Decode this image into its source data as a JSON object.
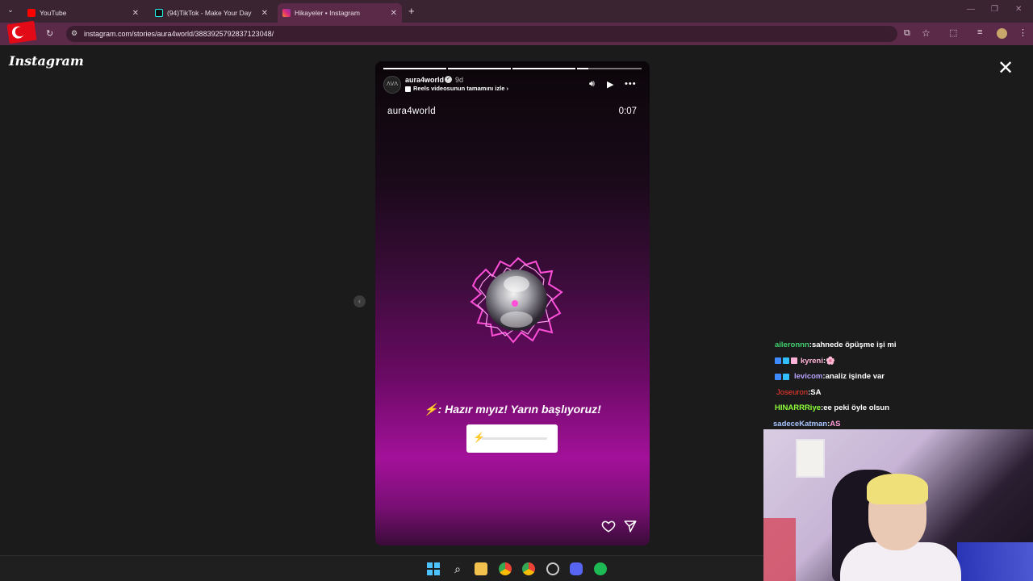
{
  "browser": {
    "tabs": [
      {
        "title": "YouTube",
        "color": "#ff0000"
      },
      {
        "title": "(94)TikTok - Make Your Day",
        "color": "#000000"
      },
      {
        "title": "Hikayeler • Instagram",
        "color": "#e1306c"
      }
    ],
    "new_tab": "+",
    "url": "instagram.com/stories/aura4world/3883925792837123048/"
  },
  "instagram": {
    "logo": "Instagram",
    "story": {
      "username": "aura4world",
      "age": "9d",
      "reels_link": "Reels videosunun tamamını izle",
      "title": "aura4world",
      "timer": "0:07",
      "caption": "⚡: Hazır mıyız! Yarın başlıyoruz!",
      "progress_segments": [
        1,
        1,
        1,
        0.1
      ]
    }
  },
  "chat": [
    {
      "user": "aileronnn",
      "sep": " : ",
      "msg": "sahnede öpüşme işi mi",
      "color": "#3fd16f"
    },
    {
      "user": "kyreni",
      "sep": " : ",
      "msg": "🌸",
      "color": "#ffb3d9"
    },
    {
      "user": "levicom",
      "sep": " : ",
      "msg": "analiz işinde var",
      "color": "#b9a3ff"
    },
    {
      "user": "Joseuron",
      "sep": " : ",
      "msg": "SA",
      "color": "#ff3b30"
    },
    {
      "user": "HINARRRiye",
      "sep": " : ",
      "msg": "ee peki öyle olsun",
      "color": "#8cff3a"
    },
    {
      "user": "sadeceKatman",
      "sep": " : ",
      "msg": "AS",
      "color": "#a8c4ff"
    }
  ]
}
